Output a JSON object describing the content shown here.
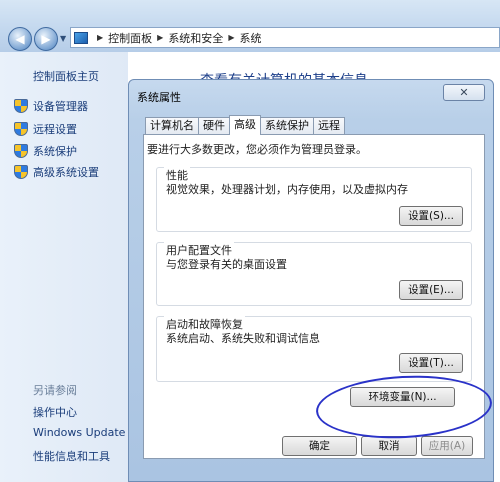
{
  "address_bar": {
    "crumbs": [
      "控制面板",
      "系统和安全",
      "系统"
    ]
  },
  "left_pane": {
    "home": "控制面板主页",
    "items": [
      "设备管理器",
      "远程设置",
      "系统保护",
      "高级系统设置"
    ],
    "see_also_label": "另请参阅",
    "see_also_links": [
      "操作中心",
      "Windows Update",
      "性能信息和工具"
    ]
  },
  "content": {
    "title": "查看有关计算机的基本信息"
  },
  "dialog": {
    "title": "系统属性",
    "tabs": [
      "计算机名",
      "硬件",
      "高级",
      "系统保护",
      "远程"
    ],
    "active_tab": "高级",
    "intro": "要进行大多数更改，您必须作为管理员登录。",
    "groups": [
      {
        "title": "性能",
        "desc": "视觉效果，处理器计划，内存使用，以及虚拟内存",
        "button": "设置(S)..."
      },
      {
        "title": "用户配置文件",
        "desc": "与您登录有关的桌面设置",
        "button": "设置(E)..."
      },
      {
        "title": "启动和故障恢复",
        "desc": "系统启动、系统失败和调试信息",
        "button": "设置(T)..."
      }
    ],
    "env_button": "环境变量(N)...",
    "ok": "确定",
    "cancel": "取消",
    "apply": "应用(A)"
  },
  "annotation_color": "#2a32c8"
}
